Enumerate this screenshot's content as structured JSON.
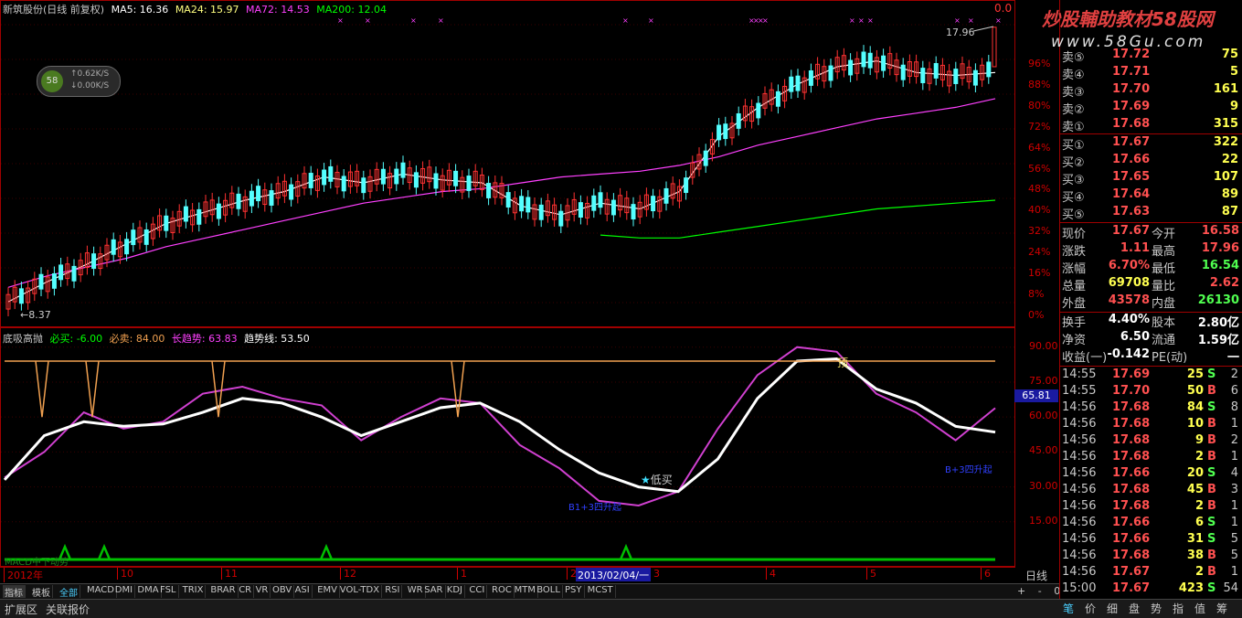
{
  "header": {
    "title": "新筑股份(日线 前复权)",
    "ma5": "MA5: 16.36",
    "ma24": "MA24: 15.97",
    "ma72": "MA72: 14.53",
    "ma200": "MA200: 12.04"
  },
  "top_right_label": "0.0",
  "watermark": {
    "line1": "炒股輔助教材58股网",
    "line2": "www.58Gu.com"
  },
  "badge": {
    "up": "↑0.62K/S",
    "down": "↓0.00K/S",
    "logo": "58"
  },
  "price_annotations": {
    "high": "17.96",
    "low": "8.37"
  },
  "price_axis": [
    "96%",
    "88%",
    "80%",
    "72%",
    "64%",
    "56%",
    "48%",
    "40%",
    "32%",
    "24%",
    "16%",
    "8%",
    "0%"
  ],
  "indicator": {
    "name": "底吸高抛",
    "bixi": "必买: -6.00",
    "bimai": "必卖: 84.00",
    "changqushi": "长趋势: 63.83",
    "qushixian": "趋势线: 53.50",
    "axis": [
      "90.00",
      "75.00",
      "60.00",
      "45.00",
      "30.00",
      "15.00"
    ],
    "current": "65.81",
    "label_top": "顶",
    "label_dixi": "低买",
    "label_bottom1": "B1+3四升起",
    "label_bottom2": "B+3四升起"
  },
  "indicator2": {
    "name": "MACD中下动势"
  },
  "time_axis": {
    "labels": [
      "2012年",
      "10",
      "11",
      "12",
      "1",
      "2",
      "3",
      "4",
      "5",
      "6"
    ],
    "cursor": "2013/02/04/一",
    "period": "日线"
  },
  "order_book": [
    {
      "label": "卖⑤",
      "price": "17.72",
      "vol": "75"
    },
    {
      "label": "卖④",
      "price": "17.71",
      "vol": "5"
    },
    {
      "label": "卖③",
      "price": "17.70",
      "vol": "161"
    },
    {
      "label": "卖②",
      "price": "17.69",
      "vol": "9"
    },
    {
      "label": "卖①",
      "price": "17.68",
      "vol": "315"
    },
    {
      "label": "买①",
      "price": "17.67",
      "vol": "322"
    },
    {
      "label": "买②",
      "price": "17.66",
      "vol": "22"
    },
    {
      "label": "买③",
      "price": "17.65",
      "vol": "107"
    },
    {
      "label": "买④",
      "price": "17.64",
      "vol": "89"
    },
    {
      "label": "买⑤",
      "price": "17.63",
      "vol": "87"
    }
  ],
  "stats": [
    {
      "l1": "现价",
      "v1": "17.67",
      "l2": "今开",
      "v2": "16.58"
    },
    {
      "l1": "涨跌",
      "v1": "1.11",
      "l2": "最高",
      "v2": "17.96"
    },
    {
      "l1": "涨幅",
      "v1": "6.70%",
      "l2": "最低",
      "v2": "16.54"
    },
    {
      "l1": "总量",
      "v1": "69708",
      "l2": "量比",
      "v2": "2.62"
    },
    {
      "l1": "外盘",
      "v1": "43578",
      "l2": "内盘",
      "v2": "26130"
    },
    {
      "l1": "换手",
      "v1": "4.40%",
      "l2": "股本",
      "v2": "2.80亿"
    },
    {
      "l1": "净资",
      "v1": "6.50",
      "l2": "流通",
      "v2": "1.59亿"
    },
    {
      "l1": "收益(一)",
      "v1": "-0.142",
      "l2": "PE(动)",
      "v2": "一"
    }
  ],
  "ticks": [
    {
      "t": "14:55",
      "p": "17.69",
      "v": "25",
      "s": "S",
      "n": "2"
    },
    {
      "t": "14:55",
      "p": "17.70",
      "v": "50",
      "s": "B",
      "n": "6"
    },
    {
      "t": "14:56",
      "p": "17.68",
      "v": "84",
      "s": "S",
      "n": "8"
    },
    {
      "t": "14:56",
      "p": "17.68",
      "v": "10",
      "s": "B",
      "n": "1"
    },
    {
      "t": "14:56",
      "p": "17.68",
      "v": "9",
      "s": "B",
      "n": "2"
    },
    {
      "t": "14:56",
      "p": "17.68",
      "v": "2",
      "s": "B",
      "n": "1"
    },
    {
      "t": "14:56",
      "p": "17.66",
      "v": "20",
      "s": "S",
      "n": "4"
    },
    {
      "t": "14:56",
      "p": "17.68",
      "v": "45",
      "s": "B",
      "n": "3"
    },
    {
      "t": "14:56",
      "p": "17.68",
      "v": "2",
      "s": "B",
      "n": "1"
    },
    {
      "t": "14:56",
      "p": "17.66",
      "v": "6",
      "s": "S",
      "n": "1"
    },
    {
      "t": "14:56",
      "p": "17.66",
      "v": "31",
      "s": "S",
      "n": "5"
    },
    {
      "t": "14:56",
      "p": "17.68",
      "v": "38",
      "s": "B",
      "n": "5"
    },
    {
      "t": "14:56",
      "p": "17.67",
      "v": "2",
      "s": "B",
      "n": "1"
    },
    {
      "t": "15:00",
      "p": "17.67",
      "v": "423",
      "s": "S",
      "n": "54"
    }
  ],
  "tabs": [
    "指标",
    "模板",
    "全部",
    "MACD",
    "DMI",
    "DMA",
    "FSL",
    "TRIX",
    "BRAR",
    "CR",
    "VR",
    "OBV",
    "ASI",
    "EMV",
    "VOL-TDX",
    "RSI",
    "WR",
    "SAR",
    "KDJ",
    "CCI",
    "ROC",
    "MTM",
    "BOLL",
    "PSY",
    "MCST"
  ],
  "tab_controls": [
    "+",
    "-",
    "0"
  ],
  "bottom_tabs": [
    "扩展区",
    "关联报价"
  ],
  "right_tabs": [
    "笔",
    "价",
    "细",
    "盘",
    "势",
    "指",
    "值",
    "筹"
  ],
  "colors": {
    "up": "#ff3232",
    "down": "#54ffff",
    "ma5": "#ffffff",
    "ma24": "#ffff80",
    "ma72": "#ff40ff",
    "ma200": "#00ff00",
    "grid": "#800000",
    "orange": "#f0a050",
    "magenta": "#d040d0"
  },
  "chart_data": [
    {
      "type": "line",
      "title": "新筑股份(日线 前复权)",
      "series": [
        {
          "name": "MA5",
          "values": [
            8.5,
            9.2,
            9.8,
            10.5,
            11.2,
            11.6,
            12.0,
            12.3,
            12.8,
            12.6,
            12.9,
            12.7,
            12.6,
            11.8,
            11.5,
            11.9,
            11.7,
            12.3,
            14.2,
            15.2,
            16.0,
            16.6,
            16.8,
            16.4,
            16.3,
            16.4
          ]
        },
        {
          "name": "MA72",
          "values": [
            9.0,
            9.4,
            9.7,
            10.0,
            10.4,
            10.7,
            11.0,
            11.3,
            11.6,
            11.9,
            12.1,
            12.3,
            12.4,
            12.6,
            12.8,
            12.9,
            13.0,
            13.2,
            13.5,
            13.9,
            14.2,
            14.5,
            14.8,
            15.0,
            15.2,
            15.5
          ]
        },
        {
          "name": "MA200",
          "values": [
            null,
            null,
            null,
            null,
            null,
            null,
            null,
            null,
            null,
            null,
            null,
            null,
            null,
            null,
            null,
            10.8,
            10.7,
            10.7,
            10.9,
            11.1,
            11.3,
            11.5,
            11.7,
            11.8,
            11.9,
            12.0
          ]
        }
      ],
      "price_high": 17.96,
      "price_low": 8.37
    },
    {
      "type": "line",
      "title": "底吸高抛",
      "ylim": [
        0,
        95
      ],
      "series": [
        {
          "name": "长趋势",
          "values": [
            34,
            45,
            62,
            55,
            58,
            70,
            73,
            68,
            65,
            50,
            60,
            68,
            66,
            48,
            38,
            24,
            22,
            28,
            55,
            78,
            90,
            88,
            70,
            62,
            50,
            63.83
          ]
        },
        {
          "name": "趋势线",
          "values": [
            33,
            52,
            58,
            56,
            57,
            62,
            68,
            66,
            60,
            52,
            58,
            64,
            66,
            58,
            46,
            36,
            30,
            28,
            42,
            68,
            84,
            85,
            72,
            66,
            56,
            53.5
          ]
        },
        {
          "name": "必卖",
          "values": [
            84,
            84,
            84,
            84,
            84,
            84,
            84,
            84,
            84,
            84,
            84,
            84,
            84,
            84,
            84,
            84,
            84,
            84,
            84,
            84,
            84,
            84,
            84,
            84,
            84,
            84
          ]
        }
      ]
    }
  ]
}
